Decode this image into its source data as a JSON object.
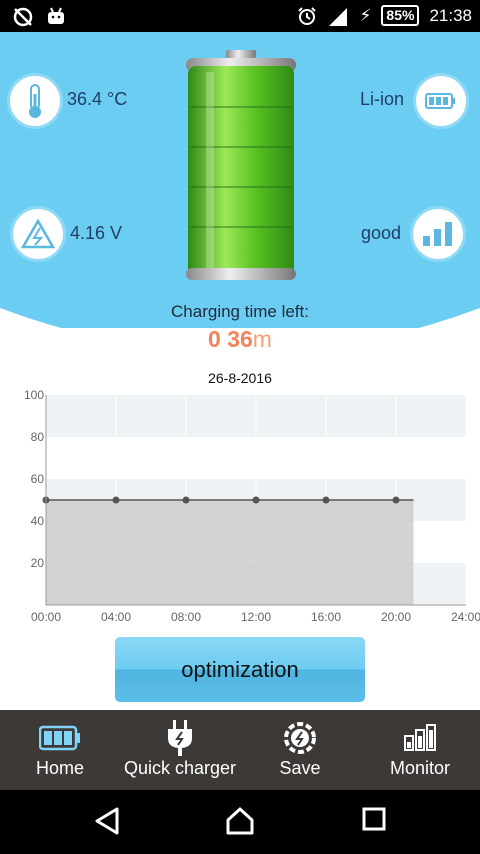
{
  "status_bar": {
    "battery_percent": "85%",
    "time": "21:38",
    "icons": [
      "sync-off-icon",
      "android-icon",
      "alarm-icon",
      "signal-icon",
      "charging-bolt-icon",
      "battery-icon"
    ]
  },
  "info": {
    "temperature": "36.4 °C",
    "voltage": "4.16 V",
    "technology": "Li-ion",
    "health": "good",
    "battery_level": 0.85
  },
  "charging": {
    "label": "Charging time left:",
    "hours": "0",
    "minutes": "36",
    "minutes_unit": "m"
  },
  "chart_data": {
    "type": "area",
    "title": "26-8-2016",
    "x": [
      "00:00",
      "04:00",
      "08:00",
      "12:00",
      "16:00",
      "20:00"
    ],
    "values": [
      50,
      50,
      50,
      50,
      50,
      50
    ],
    "x_ticks": [
      "00:00",
      "04:00",
      "08:00",
      "12:00",
      "16:00",
      "20:00",
      "24:00"
    ],
    "y_ticks": [
      "20",
      "40",
      "60",
      "80",
      "100"
    ],
    "ylim": [
      0,
      100
    ],
    "xlim_hours": [
      0,
      24
    ],
    "fill_end_hour": 21,
    "grid": true,
    "colors": {
      "line": "#555555",
      "fill": "#cccccc",
      "band": "#eef2f5"
    }
  },
  "optimization_button": {
    "label": "optimization"
  },
  "tabs": [
    {
      "label": "Home",
      "icon": "battery-icon",
      "active": true
    },
    {
      "label": "Quick charger",
      "icon": "plug-icon",
      "active": false
    },
    {
      "label": "Save",
      "icon": "power-saving-icon",
      "active": false
    },
    {
      "label": "Monitor",
      "icon": "bar-chart-icon",
      "active": false
    }
  ],
  "nav": {
    "icons": [
      "back-icon",
      "home-icon",
      "recents-icon"
    ]
  },
  "colors": {
    "accent": "#6ccdf2",
    "tab_bar": "#3d3937",
    "time_color": "#f0845a",
    "active_tab_icon": "#7fd4f7"
  }
}
